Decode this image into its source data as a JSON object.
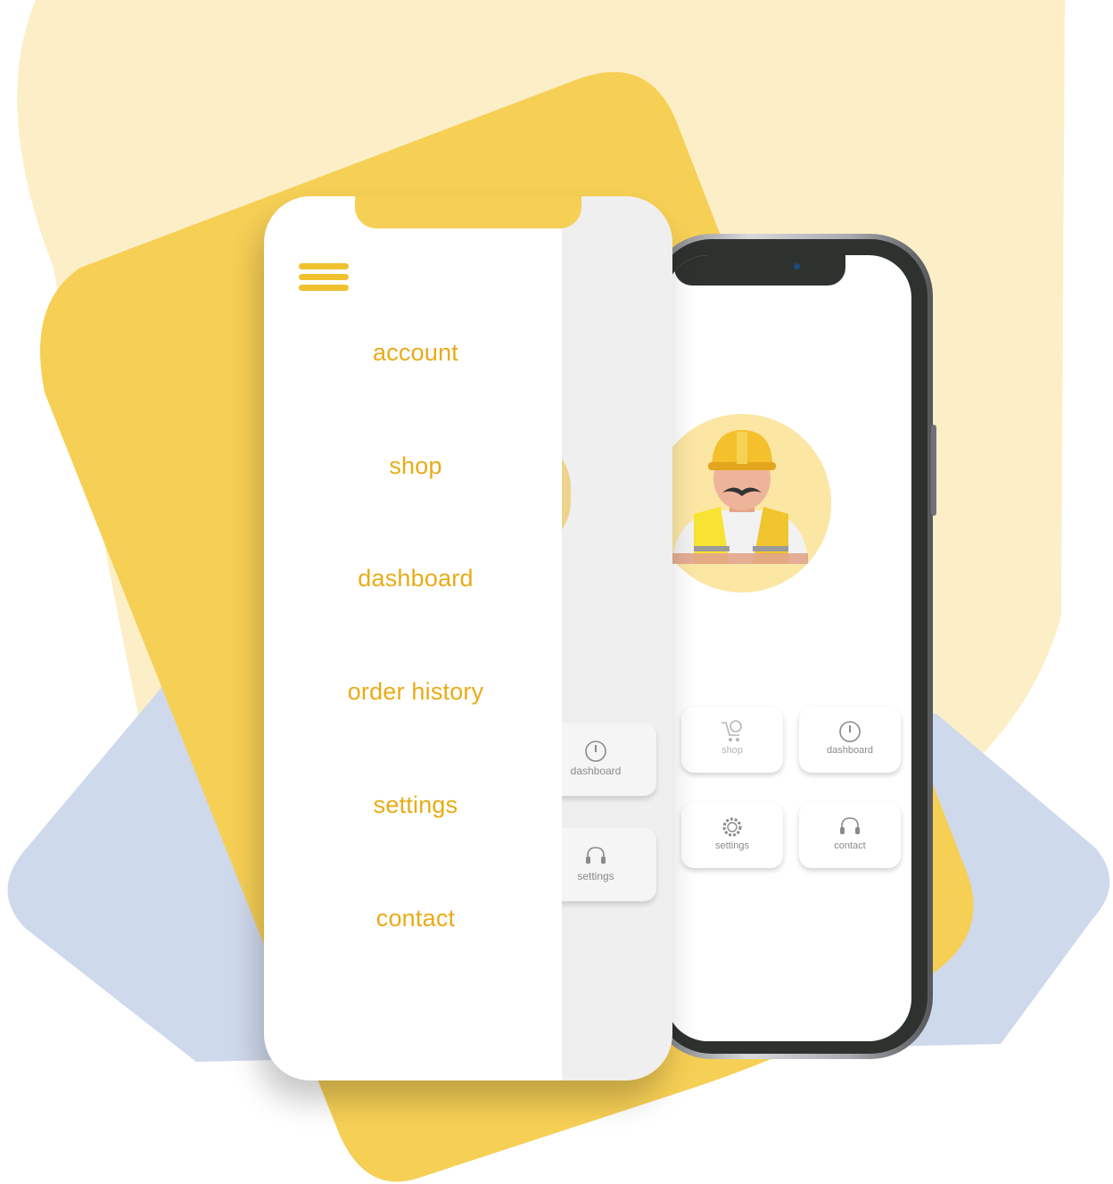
{
  "drawer_menu": {
    "items": [
      {
        "label": "account"
      },
      {
        "label": "shop"
      },
      {
        "label": "dashboard"
      },
      {
        "label": "order history"
      },
      {
        "label": "settings"
      },
      {
        "label": "contact"
      }
    ]
  },
  "back_screen": {
    "tiles": [
      {
        "label": "shop",
        "icon": "cart-icon"
      },
      {
        "label": "dashboard",
        "icon": "gauge-icon"
      },
      {
        "label": "settings",
        "icon": "gear-icon"
      },
      {
        "label": "contact",
        "icon": "headset-icon"
      }
    ]
  },
  "front_screen": {
    "tiles": [
      {
        "label": "dashboard",
        "icon": "gauge-icon"
      },
      {
        "label": "settings",
        "icon": "headset-icon"
      }
    ]
  },
  "colors": {
    "accent_yellow": "#f6cf55",
    "menu_text": "#e9ab17",
    "pale_yellow": "#fcefc7",
    "pale_blue": "#cfd9ec"
  }
}
